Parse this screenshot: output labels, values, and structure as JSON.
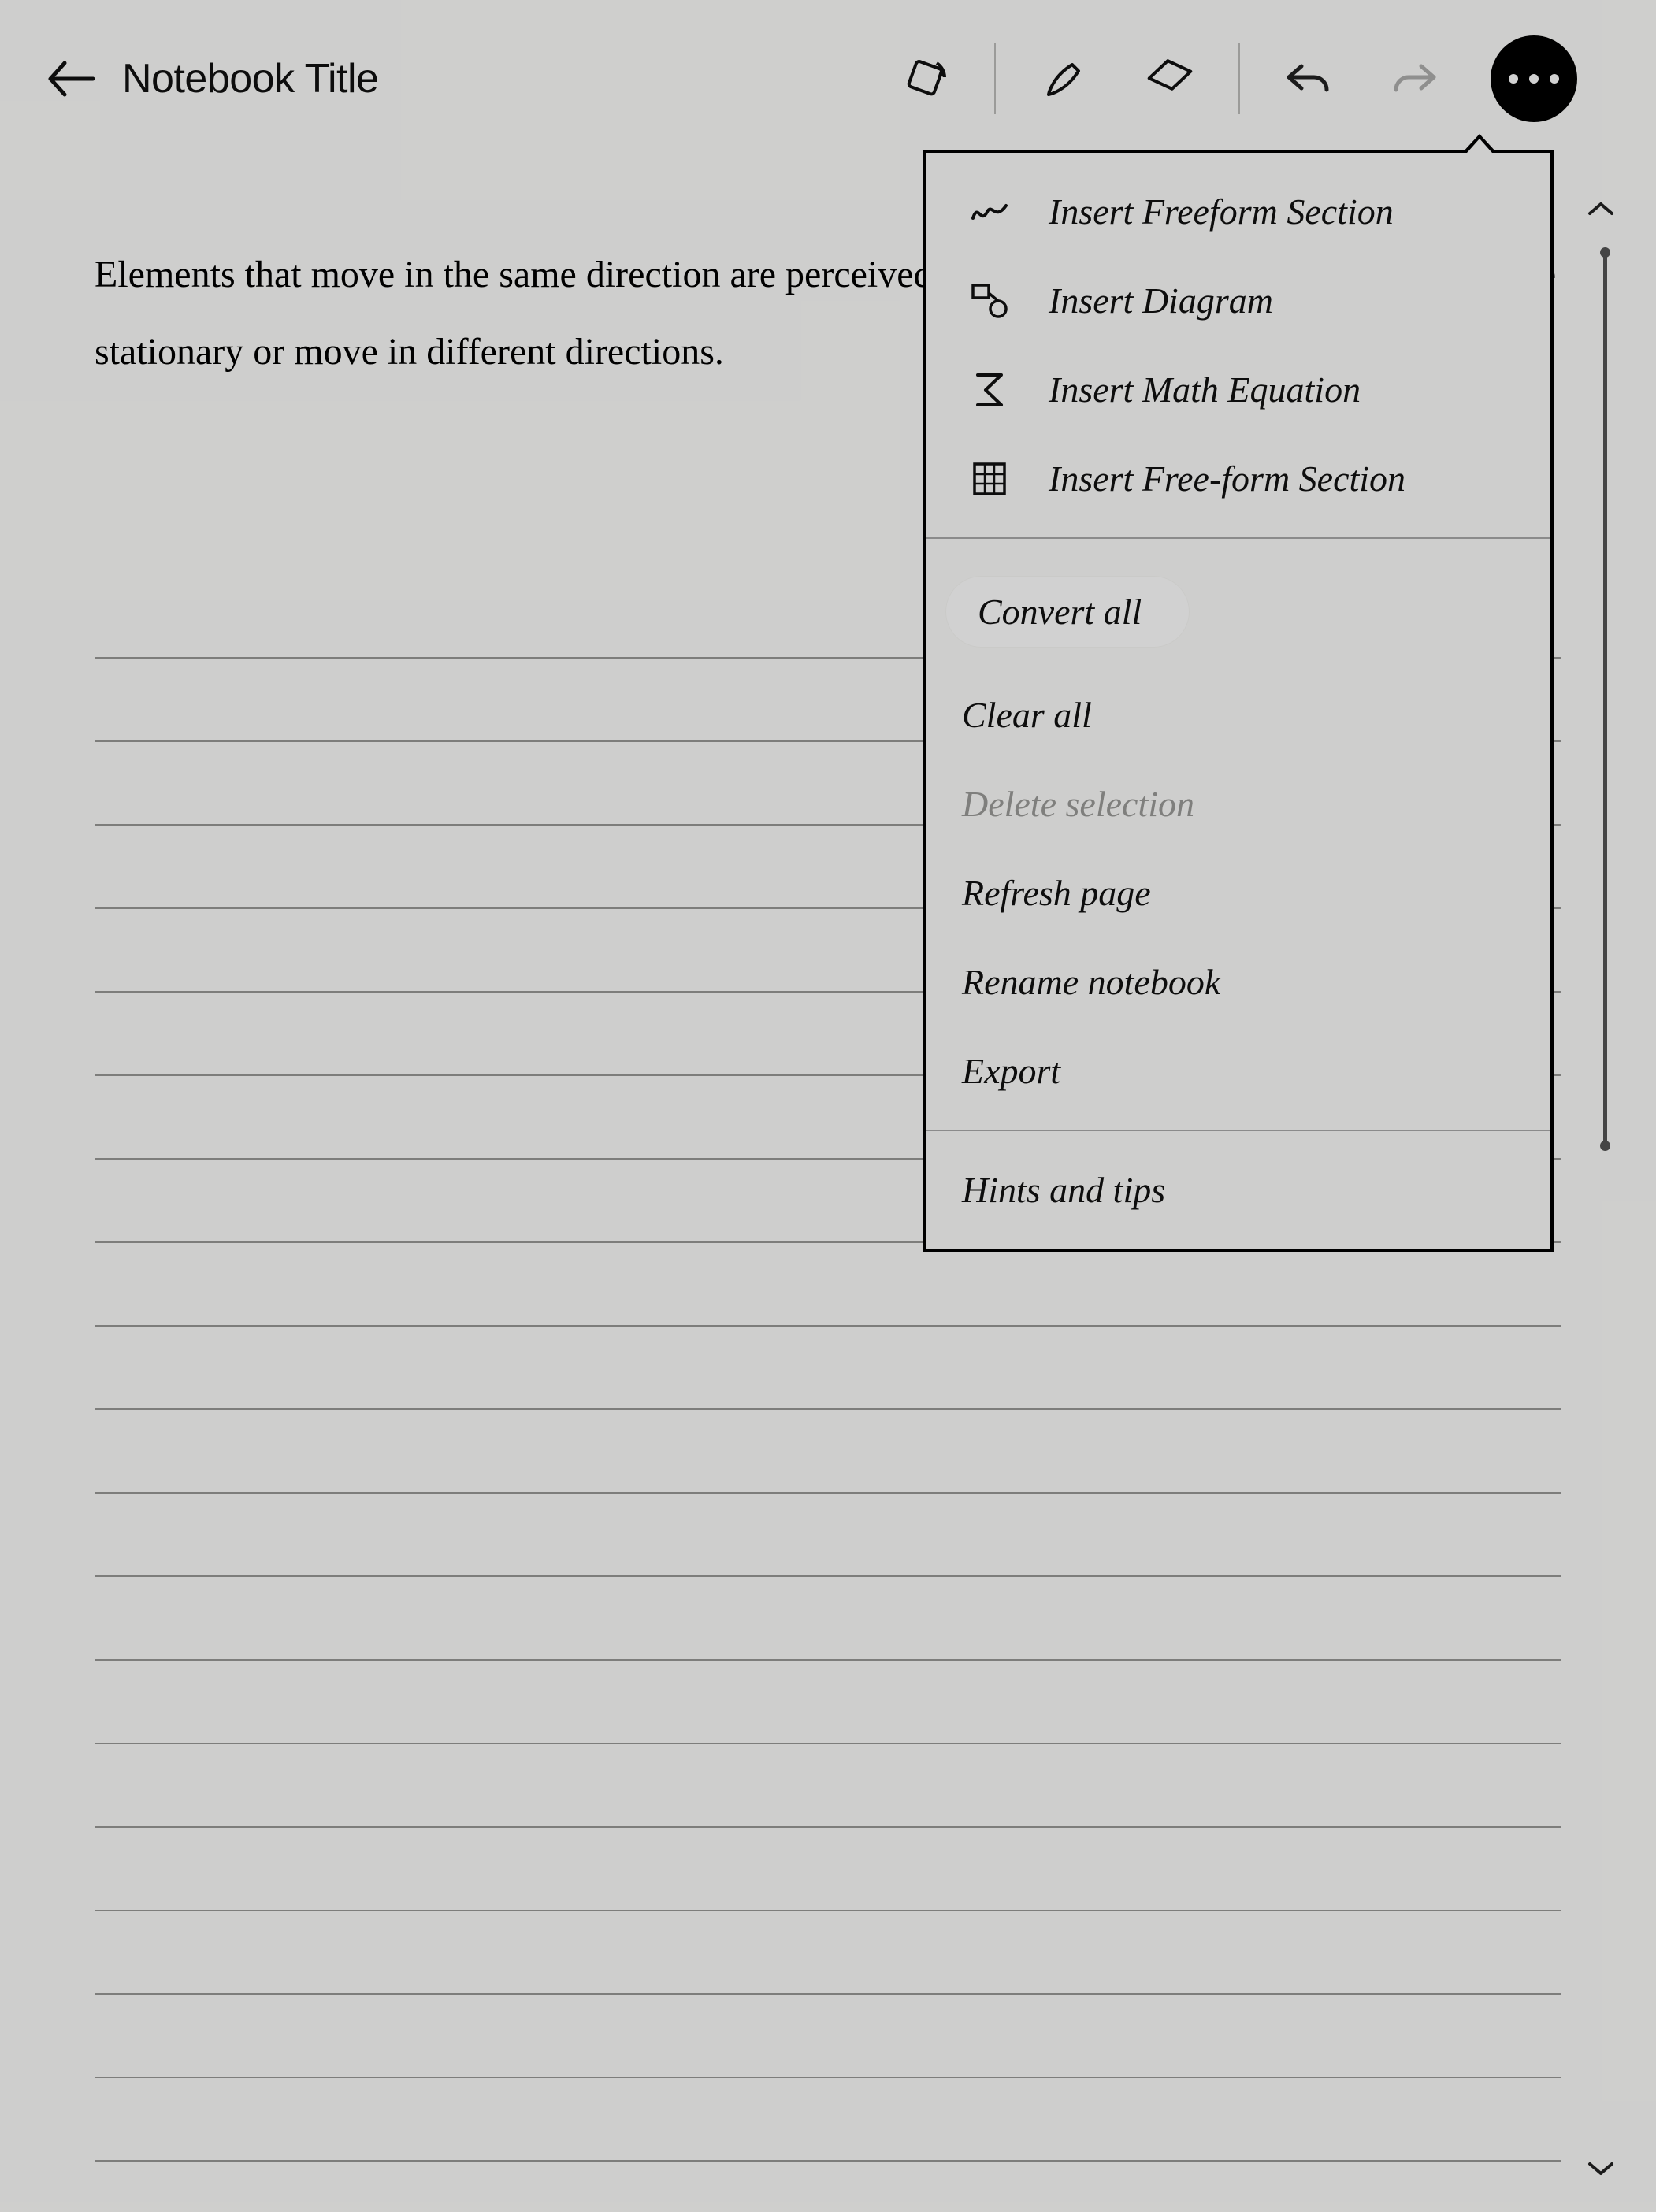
{
  "header": {
    "title": "Notebook Title"
  },
  "note": {
    "text": "Elements that move in the same direction are perceived to be related more than elements that are stationary or move in different directions."
  },
  "toolbar": {
    "rotate": "rotate-icon",
    "pen": "pen-icon",
    "eraser": "eraser-icon",
    "undo": "undo-icon",
    "redo": "redo-icon",
    "more": "more-icon"
  },
  "menu": {
    "insert": [
      {
        "icon": "freeform-icon",
        "label": "Insert Freeform Section"
      },
      {
        "icon": "diagram-icon",
        "label": "Insert Diagram"
      },
      {
        "icon": "math-icon",
        "label": "Insert Math Equation"
      },
      {
        "icon": "grid-icon",
        "label": "Insert Free-form Section"
      }
    ],
    "actions": [
      {
        "label": "Convert all",
        "highlighted": true,
        "disabled": false
      },
      {
        "label": "Clear all",
        "highlighted": false,
        "disabled": false
      },
      {
        "label": "Delete selection",
        "highlighted": false,
        "disabled": true
      },
      {
        "label": "Refresh page",
        "highlighted": false,
        "disabled": false
      },
      {
        "label": "Rename notebook",
        "highlighted": false,
        "disabled": false
      },
      {
        "label": "Export",
        "highlighted": false,
        "disabled": false
      }
    ],
    "footer": [
      {
        "label": "Hints and tips"
      }
    ]
  }
}
